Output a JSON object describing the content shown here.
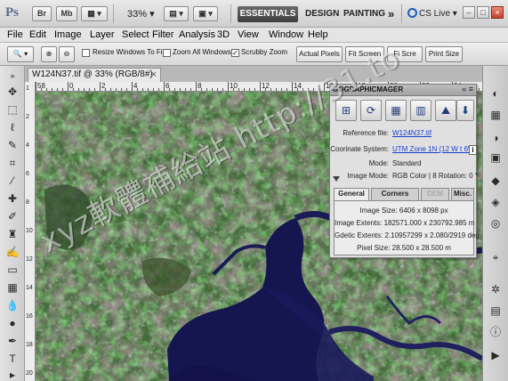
{
  "app": {
    "logo_text": "Ps",
    "bridge_btn": "Br",
    "minibridge_btn": "Mb",
    "zoom": "33%",
    "workspaces": [
      "ESSENTIALS",
      "DESIGN",
      "PAINTING"
    ],
    "more_workspaces": "»",
    "cslive": "CS Live",
    "win_min": "–",
    "win_max": "□",
    "win_close": "×"
  },
  "menu": [
    "File",
    "Edit",
    "Image",
    "Layer",
    "Select",
    "Filter",
    "Analysis",
    "3D",
    "View",
    "Window",
    "Help"
  ],
  "options": {
    "resize_windows": "Resize Windows To Fit",
    "zoom_all": "Zoom All Windows",
    "scrubby": "Scrubby Zoom",
    "actual_pixels": "Actual Pixels",
    "fit_screen": "Fit Screen",
    "fill_screen": "Fi Scre",
    "print_size": "Print Size"
  },
  "document": {
    "tab_title": "W124N37.tif @ 33% (RGB/8#)",
    "close": "×"
  },
  "rulers": {
    "top": [
      "58",
      "0",
      "2",
      "4",
      "6",
      "8",
      "10",
      "12",
      "14",
      "16",
      "18",
      "20",
      "22",
      "24"
    ],
    "left": [
      "1",
      "2",
      "4",
      "6",
      "8",
      "10",
      "12",
      "14",
      "16",
      "18",
      "20"
    ]
  },
  "panel": {
    "title": "GOGRAPHICMAGER",
    "head_buttons": "«  ≡",
    "reference_label": "Reference file:",
    "reference_value": "W124N37.tif",
    "coord_label": "Coorinate System:",
    "coord_value": "UTM Zone 1N (12 W t 6W)",
    "mode_label": "Mode:",
    "mode_value": "Standard",
    "imgmode_label": "Image Mode:",
    "imgmode_value": "RGB Color | 8 Rotation: 0 °",
    "tabs": [
      "General",
      "Corners",
      "DEM",
      "Misc."
    ],
    "info": [
      "Image Size: 6406 x 8098 px",
      "Image Extents: 182571.000 x 230792.985 m",
      "Gdetic Extents: 2.10957299 x 2.080/2919 deg",
      "Pixel Size: 28.500 x 28.500 m"
    ]
  },
  "watermark": "xyz軟體補給站 http://31.to",
  "colors": {
    "accent": "#1a3fcf",
    "essentials_bg": "#4a4a4a"
  }
}
